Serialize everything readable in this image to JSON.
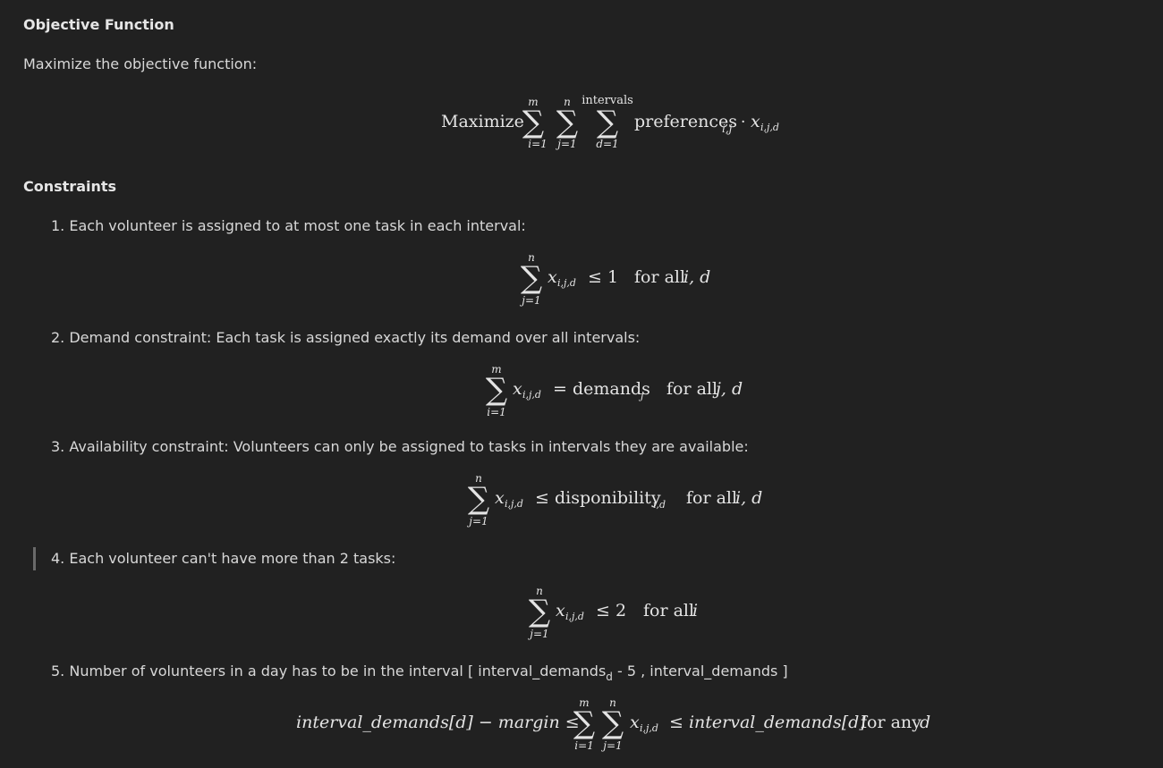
{
  "sections": {
    "objective_heading": "Objective Function",
    "objective_text": "Maximize the objective function:",
    "constraints_heading": "Constraints"
  },
  "objective_formula": {
    "word": "Maximize",
    "sum1_top": "m",
    "sum1_bottom": "i=1",
    "sum2_top": "n",
    "sum2_bottom": "j=1",
    "sum3_top": "intervals",
    "sum3_bottom": "d=1",
    "term": "preferences",
    "term_sub": "i,j",
    "dot": "·",
    "var": "x",
    "var_sub": "i,j,d"
  },
  "constraints": [
    {
      "label": "1. Each volunteer is assigned to at most one task in each interval:",
      "sum_top": "n",
      "sum_bottom": "j=1",
      "var": "x",
      "var_sub": "i,j,d",
      "relation": "≤ 1",
      "qualifier": "for all",
      "indices": "i, d"
    },
    {
      "label": "2. Demand constraint: Each task is assigned exactly its demand over all intervals:",
      "sum_top": "m",
      "sum_bottom": "i=1",
      "var": "x",
      "var_sub": "i,j,d",
      "relation": "= demands",
      "relation_sub": "j",
      "qualifier": "for all",
      "indices": "j, d"
    },
    {
      "label": "3. Availability constraint: Volunteers can only be assigned to tasks in intervals they are available:",
      "sum_top": "n",
      "sum_bottom": "j=1",
      "var": "x",
      "var_sub": "i,j,d",
      "relation": "≤ disponibility",
      "relation_sub": "i,d",
      "qualifier": "for all",
      "indices": "i, d"
    },
    {
      "label": "4. Each volunteer can't have more than 2 tasks:",
      "sum_top": "n",
      "sum_bottom": "j=1",
      "var": "x",
      "var_sub": "i,j,d",
      "relation": "≤ 2",
      "qualifier": "for all",
      "indices": "i"
    },
    {
      "label_pre": "5. Number of volunteers in a day has to be in the interval [ interval_demands",
      "label_sub": "d",
      "label_post": " - 5 , interval_demands ]",
      "left": "interval_demands[d] − margin ≤",
      "sum1_top": "m",
      "sum1_bottom": "i=1",
      "sum2_top": "n",
      "sum2_bottom": "j=1",
      "var": "x",
      "var_sub": "i,j,d",
      "right": "≤ interval_demands[d]",
      "qualifier": "for any",
      "indices": "d"
    }
  ]
}
